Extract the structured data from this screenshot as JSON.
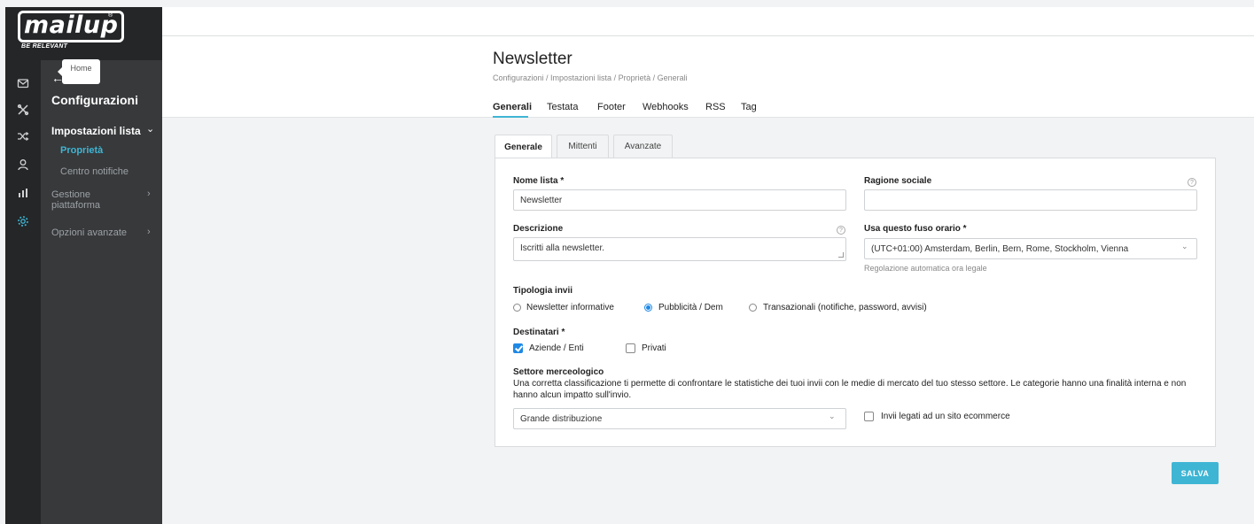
{
  "brand": {
    "logo": "mailup",
    "reg": "®",
    "tagline": "BE RELEVANT"
  },
  "rail": {
    "icons": [
      "mail-icon",
      "tools-icon",
      "shuffle-icon",
      "contacts-icon",
      "statistics-icon",
      "gear-icon"
    ]
  },
  "sidebar": {
    "back_arrow": "←",
    "tooltip": "Home",
    "title": "Configurazioni",
    "items": [
      {
        "label": "Impostazioni lista",
        "chevron": "⌄"
      },
      {
        "label": "Proprietà"
      },
      {
        "label": "Centro notifiche"
      },
      {
        "label": "Gestione piattaforma",
        "chevron": "›"
      },
      {
        "label": "Opzioni avanzate",
        "chevron": "›"
      }
    ]
  },
  "header": {
    "title": "Newsletter",
    "breadcrumb": "Configurazioni / Impostazioni lista / Proprietà / Generali",
    "tabs": [
      "Generali",
      "Testata",
      "Footer",
      "Webhooks",
      "RSS",
      "Tag"
    ],
    "active_tab": "Generali"
  },
  "subtabs": [
    "Generale",
    "Mittenti",
    "Avanzate"
  ],
  "form": {
    "list_name_label": "Nome lista *",
    "list_name_value": "Newsletter",
    "company_label": "Ragione sociale",
    "company_value": "",
    "description_label": "Descrizione",
    "description_value": "Iscritti alla newsletter.",
    "timezone_label": "Usa questo fuso orario *",
    "timezone_value": "(UTC+01:00) Amsterdam, Berlin, Bern, Rome, Stockholm, Vienna",
    "timezone_hint": "Regolazione automatica ora legale",
    "help_glyph": "?",
    "select_chevron": "⌄",
    "send_type_label": "Tipologia invii",
    "send_types": [
      "Newsletter informative",
      "Pubblicità / Dem",
      "Transazionali (notifiche, password, avvisi)"
    ],
    "send_type_selected": "Pubblicità / Dem",
    "recipients_label": "Destinatari *",
    "recipients": [
      {
        "label": "Aziende / Enti",
        "checked": true
      },
      {
        "label": "Privati",
        "checked": false
      }
    ],
    "sector_label": "Settore merceologico",
    "sector_desc": "Una corretta classificazione ti permette di confrontare le statistiche dei tuoi invii con le medie di mercato del tuo stesso settore. Le categorie hanno una finalità interna e non hanno alcun impatto sull'invio.",
    "sector_value": "Grande distribuzione",
    "ecommerce_label": "Invii legati ad un sito ecommerce",
    "ecommerce_checked": false
  },
  "save_label": "SALVA",
  "colors": {
    "accent": "#3fb5d4",
    "sidebar_dark": "#242628",
    "sidebar_panel": "#37393b",
    "radio_blue": "#1e88e5"
  }
}
